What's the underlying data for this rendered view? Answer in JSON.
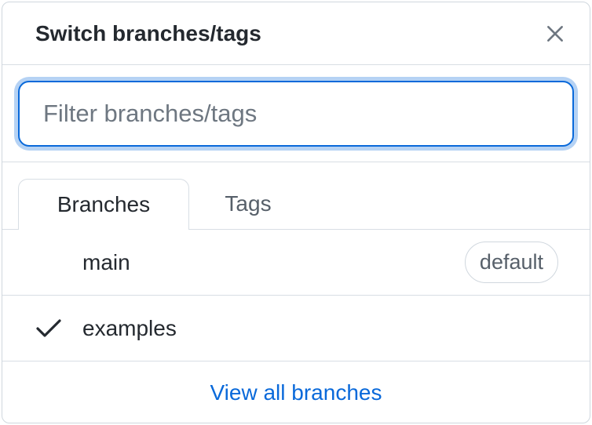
{
  "header": {
    "title": "Switch branches/tags",
    "close_icon": "close-icon"
  },
  "filter": {
    "placeholder": "Filter branches/tags",
    "value": ""
  },
  "tabs": [
    {
      "label": "Branches",
      "selected": true
    },
    {
      "label": "Tags",
      "selected": false
    }
  ],
  "branches": [
    {
      "name": "main",
      "badge": "default",
      "checked": false
    },
    {
      "name": "examples",
      "badge": "",
      "checked": true
    }
  ],
  "footer": {
    "link_label": "View all branches"
  },
  "colors": {
    "accent": "#0969da",
    "text": "#24292f",
    "muted": "#57606a",
    "border": "#d8dee4"
  }
}
